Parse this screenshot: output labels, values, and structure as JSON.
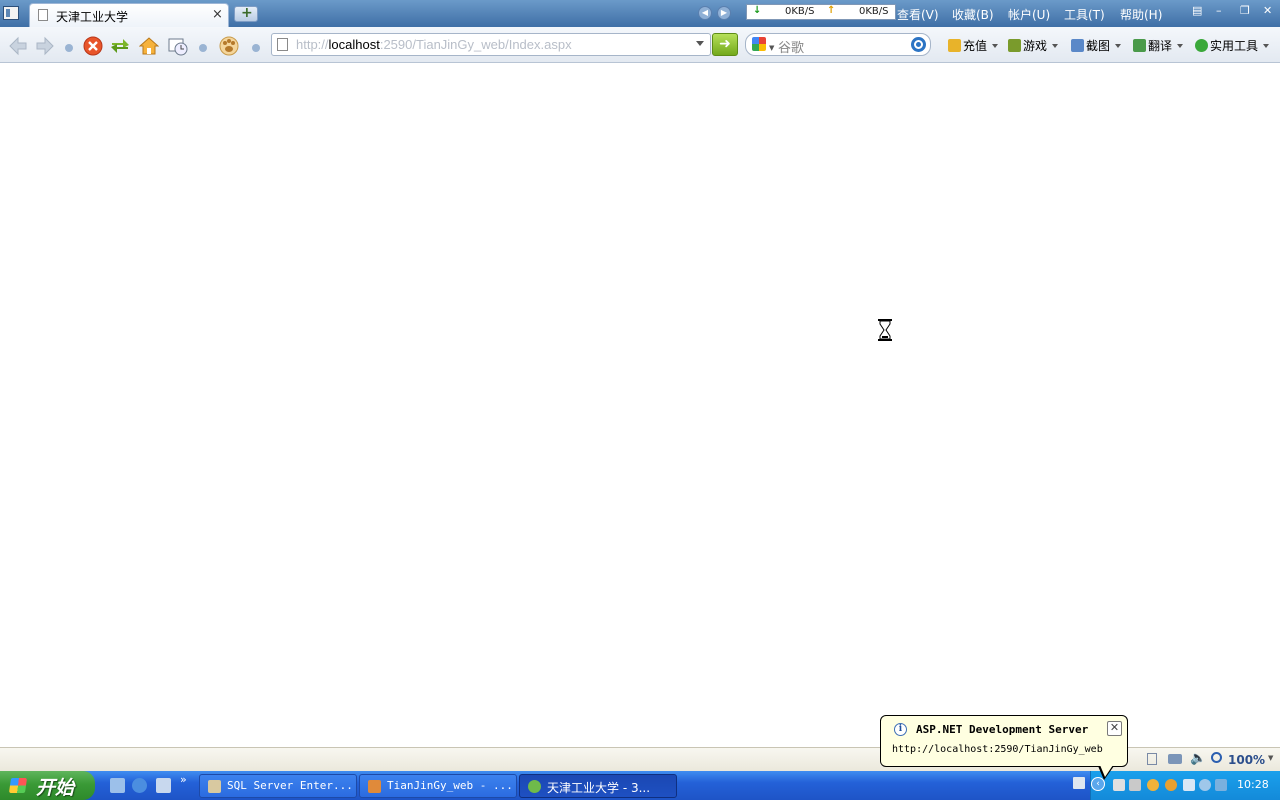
{
  "tab": {
    "title": "天津工业大学",
    "close": "×"
  },
  "speed": {
    "down": "0KB/S",
    "up": "0KB/S"
  },
  "menu": [
    "查看(V)",
    "收藏(B)",
    "帐户(U)",
    "工具(T)",
    "帮助(H)"
  ],
  "address": {
    "prefix": "http://",
    "host": "localhost",
    "rest": ":2590/TianJinGy_web/Index.aspx"
  },
  "search": {
    "placeholder": "谷歌"
  },
  "tools": [
    "充值",
    "游戏",
    "截图",
    "翻译",
    "实用工具"
  ],
  "statusbar": {
    "zoom": "100%"
  },
  "balloon": {
    "title": "ASP.NET Development Server",
    "text": "http://localhost:2590/TianJinGy_web"
  },
  "taskbar": {
    "start": "开始",
    "tasks": [
      "SQL Server Enter...",
      "TianJinGy_web - ...",
      "天津工业大学 - 3..."
    ],
    "clock": "10:28"
  },
  "colors": {
    "taskbar": "#2461d8",
    "start": "#3a9a36",
    "go": "#73a91c",
    "balloon": "#ffffe1"
  }
}
